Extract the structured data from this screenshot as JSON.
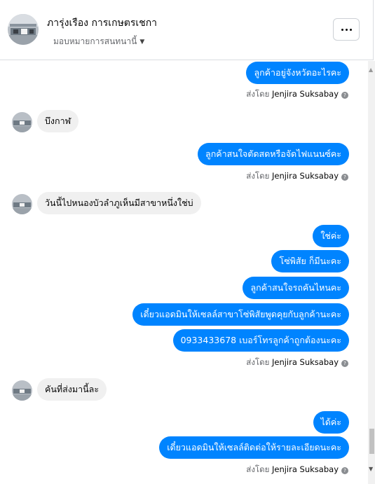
{
  "header": {
    "page_name": "ภารุ่งเรือง การเกษตรเชกา",
    "assign_label": "มอบหมายการสนทนานี้"
  },
  "messages": [
    {
      "side": "out",
      "text": "ลูกค้าอยู่จังหวัดอะไรคะ"
    },
    {
      "side": "meta",
      "prefix": "ส่งโดย",
      "sender": "Jenjira Suksabay"
    },
    {
      "side": "in",
      "text": "บึงกาฬ"
    },
    {
      "side": "out",
      "text": "ลูกค้าสนใจตัดสดหรือจัดไฟแนนซ์คะ"
    },
    {
      "side": "meta",
      "prefix": "ส่งโดย",
      "sender": "Jenjira Suksabay"
    },
    {
      "side": "in",
      "text": "วันนี้ไปหนองบัวลำภูเห็นมีสาขาหนึ่งใช่บ่"
    },
    {
      "side": "out",
      "text": "ใช่ค่ะ"
    },
    {
      "side": "out",
      "text": "โซ่พิสัย ก็มีนะคะ"
    },
    {
      "side": "out",
      "text": "ลูกค้าสนใจรถคันไหนคะ"
    },
    {
      "side": "out",
      "text": "เดี๋ยวแอดมินให้เซลล์สาขาโซ่พิสัยพูดคุยกับลูกค้านะคะ"
    },
    {
      "side": "out",
      "text": "0933433678 เบอร์โทรลูกค้าถูกต้องนะคะ"
    },
    {
      "side": "meta",
      "prefix": "ส่งโดย",
      "sender": "Jenjira Suksabay"
    },
    {
      "side": "in",
      "text": "คันที่ส่งมานี้ละ"
    },
    {
      "side": "out",
      "text": "ได้ค่ะ"
    },
    {
      "side": "out",
      "text": "เดี๋ยวแอดมินให้เซลล์ติดต่อให้รายละเอียดนะคะ"
    },
    {
      "side": "meta",
      "prefix": "ส่งโดย",
      "sender": "Jenjira Suksabay"
    }
  ],
  "colors": {
    "outgoing_bubble": "#0084ff",
    "incoming_bubble": "#f0f0f0",
    "meta_text": "#65676b"
  }
}
